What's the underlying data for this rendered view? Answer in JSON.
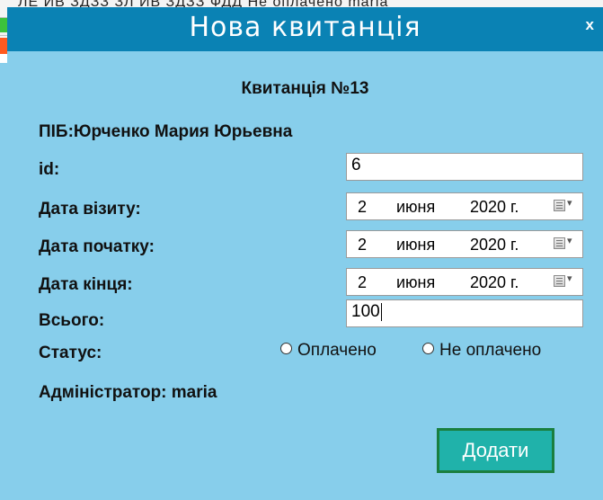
{
  "background_window": {
    "row_text": "ЛЕ ИВ ЗДЗЗ   ЗЛ ИВ ЗДЗЗ   ФДД   Не оплачено  maria"
  },
  "dialog": {
    "title": "Нова квитанція",
    "close": "x",
    "heading": "Квитанція №13",
    "pib": "ПІБ:Юрченко Мария Юрьевна",
    "id_label": "id:",
    "id_value": "6",
    "visit_label": "Дата візиту:",
    "start_label": "Дата початку:",
    "end_label": "Дата кінця:",
    "date_visit": {
      "day": "2",
      "month": "июня",
      "year": "2020 г."
    },
    "date_start": {
      "day": "2",
      "month": "июня",
      "year": "2020 г."
    },
    "date_end": {
      "day": "2",
      "month": "июня",
      "year": "2020 г."
    },
    "total_label": "Всього:",
    "total_value": "100",
    "status_label": "Статус:",
    "status_options": [
      "Оплачено",
      "Не оплачено"
    ],
    "admin": "Адміністратор: maria",
    "add_button": "Додати"
  },
  "colors": {
    "titlebar": "#0A82B4",
    "dialog_bg": "#87CEEB",
    "button_bg": "#20B2AA",
    "button_border": "#1A7F3F"
  }
}
